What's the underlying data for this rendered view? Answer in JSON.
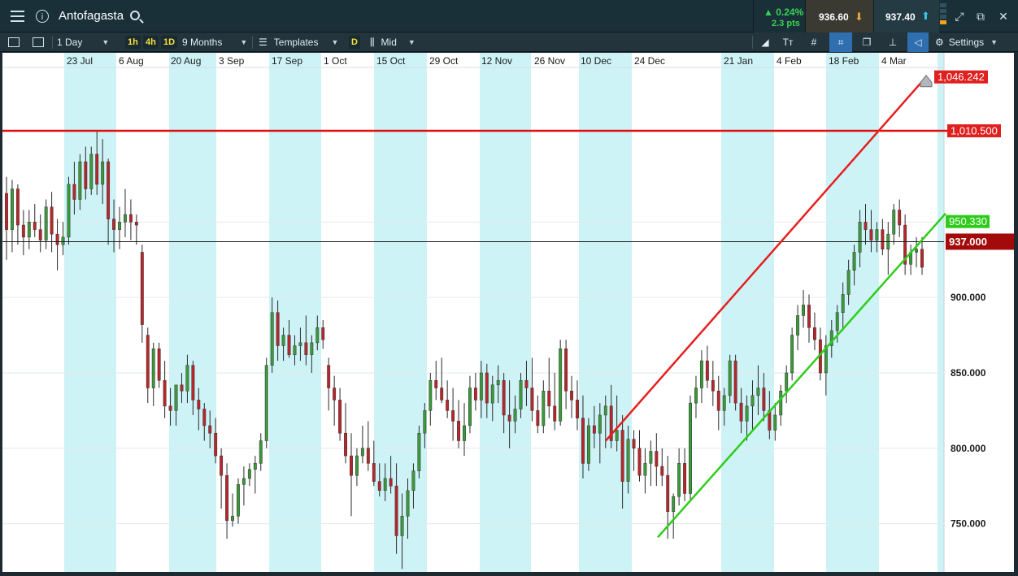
{
  "app": {
    "instrument": "Antofagasta",
    "change_pct": "▲ 0.24%",
    "change_pts": "2.3 pts",
    "sell_price": "936.60",
    "buy_price": "937.40"
  },
  "toolbar": {
    "interval": "1 Day",
    "quick_intervals": [
      "1h",
      "4h",
      "1D"
    ],
    "range": "9 Months",
    "templates_label": "Templates",
    "price_type_chip": "D",
    "price_type": "Mid",
    "settings_label": "Settings"
  },
  "chart_data": {
    "type": "candlestick",
    "x_dates": [
      "23 Jul",
      "6 Aug",
      "20 Aug",
      "3 Sep",
      "17 Sep",
      "1 Oct",
      "15 Oct",
      "29 Oct",
      "12 Nov",
      "26 Nov",
      "10 Dec",
      "24 Dec",
      "21 Jan",
      "4 Feb",
      "18 Feb",
      "4 Mar"
    ],
    "y_tick_labels": [
      "750.000",
      "800.000",
      "850.000",
      "900.000",
      "950.000"
    ],
    "ylim": [
      718,
      1052
    ],
    "price_labels": {
      "resistance": "1,010.500",
      "channel_top": "1,046.242",
      "channel_bottom": "950.330",
      "current": "937.000"
    },
    "colors": {
      "up": "#3a9a3a",
      "down": "#b8262b",
      "resistance": "#e01010",
      "channel_top": "#e81e1e",
      "channel_bottom": "#2ecc1a"
    },
    "lines": {
      "resistance": 1010.5,
      "current": 937.0,
      "channel_top": {
        "from": {
          "date": "12 Dec",
          "price": 805
        },
        "to": {
          "date": "11 Mar",
          "price": 1046.242
        }
      },
      "channel_bottom": {
        "from": {
          "date": "2 Jan",
          "price": 741
        },
        "to": {
          "date": "12 Mar",
          "price": 950.33
        }
      }
    },
    "candles": [
      [
        969,
        980,
        925,
        945
      ],
      [
        945,
        978,
        930,
        972
      ],
      [
        972,
        975,
        935,
        948
      ],
      [
        948,
        958,
        928,
        940
      ],
      [
        940,
        958,
        932,
        950
      ],
      [
        950,
        962,
        940,
        945
      ],
      [
        945,
        955,
        930,
        938
      ],
      [
        938,
        965,
        932,
        960
      ],
      [
        960,
        970,
        930,
        942
      ],
      [
        942,
        952,
        918,
        935
      ],
      [
        935,
        950,
        928,
        940
      ],
      [
        940,
        980,
        935,
        975
      ],
      [
        975,
        990,
        955,
        965
      ],
      [
        965,
        995,
        958,
        990
      ],
      [
        990,
        1000,
        965,
        972
      ],
      [
        972,
        1000,
        968,
        995
      ],
      [
        995,
        1010,
        968,
        975
      ],
      [
        975,
        1005,
        962,
        990
      ],
      [
        990,
        992,
        935,
        952
      ],
      [
        952,
        965,
        930,
        945
      ],
      [
        945,
        960,
        932,
        950
      ],
      [
        950,
        972,
        940,
        955
      ],
      [
        955,
        965,
        938,
        950
      ],
      [
        950,
        955,
        935,
        948
      ],
      [
        930,
        935,
        870,
        882
      ],
      [
        875,
        880,
        830,
        840
      ],
      [
        840,
        870,
        828,
        866
      ],
      [
        866,
        870,
        840,
        845
      ],
      [
        845,
        858,
        820,
        828
      ],
      [
        828,
        840,
        815,
        825
      ],
      [
        825,
        840,
        815,
        842
      ],
      [
        842,
        850,
        830,
        838
      ],
      [
        838,
        862,
        830,
        855
      ],
      [
        855,
        858,
        822,
        832
      ],
      [
        832,
        840,
        812,
        826
      ],
      [
        826,
        830,
        805,
        815
      ],
      [
        815,
        825,
        800,
        810
      ],
      [
        810,
        820,
        790,
        795
      ],
      [
        795,
        800,
        760,
        782
      ],
      [
        782,
        790,
        740,
        752
      ],
      [
        752,
        770,
        748,
        755
      ],
      [
        755,
        780,
        750,
        776
      ],
      [
        776,
        788,
        762,
        780
      ],
      [
        780,
        790,
        775,
        786
      ],
      [
        786,
        795,
        770,
        790
      ],
      [
        790,
        810,
        785,
        805
      ],
      [
        805,
        860,
        800,
        855
      ],
      [
        855,
        900,
        850,
        890
      ],
      [
        890,
        898,
        858,
        868
      ],
      [
        868,
        880,
        858,
        875
      ],
      [
        875,
        885,
        860,
        862
      ],
      [
        862,
        875,
        855,
        868
      ],
      [
        868,
        880,
        858,
        870
      ],
      [
        870,
        888,
        855,
        862
      ],
      [
        862,
        875,
        850,
        870
      ],
      [
        870,
        888,
        865,
        880
      ],
      [
        880,
        885,
        866,
        872
      ],
      [
        855,
        860,
        825,
        840
      ],
      [
        840,
        848,
        815,
        832
      ],
      [
        832,
        840,
        805,
        810
      ],
      [
        810,
        830,
        790,
        795
      ],
      [
        795,
        810,
        755,
        782
      ],
      [
        782,
        800,
        775,
        795
      ],
      [
        795,
        815,
        790,
        800
      ],
      [
        800,
        818,
        785,
        790
      ],
      [
        790,
        805,
        775,
        778
      ],
      [
        778,
        790,
        768,
        772
      ],
      [
        772,
        790,
        765,
        780
      ],
      [
        780,
        795,
        770,
        775
      ],
      [
        775,
        790,
        730,
        742
      ],
      [
        742,
        770,
        720,
        755
      ],
      [
        755,
        780,
        740,
        772
      ],
      [
        772,
        790,
        760,
        785
      ],
      [
        785,
        815,
        780,
        810
      ],
      [
        810,
        830,
        800,
        825
      ],
      [
        825,
        850,
        815,
        845
      ],
      [
        845,
        858,
        832,
        840
      ],
      [
        840,
        860,
        830,
        832
      ],
      [
        832,
        845,
        820,
        825
      ],
      [
        825,
        840,
        805,
        818
      ],
      [
        818,
        832,
        800,
        805
      ],
      [
        805,
        830,
        795,
        815
      ],
      [
        815,
        848,
        810,
        840
      ],
      [
        840,
        850,
        825,
        832
      ],
      [
        832,
        858,
        820,
        850
      ],
      [
        850,
        856,
        820,
        830
      ],
      [
        830,
        848,
        818,
        842
      ],
      [
        842,
        855,
        830,
        845
      ],
      [
        845,
        850,
        810,
        822
      ],
      [
        822,
        845,
        800,
        818
      ],
      [
        818,
        835,
        810,
        826
      ],
      [
        826,
        850,
        820,
        845
      ],
      [
        845,
        858,
        828,
        840
      ],
      [
        840,
        860,
        818,
        825
      ],
      [
        825,
        835,
        810,
        815
      ],
      [
        815,
        845,
        810,
        838
      ],
      [
        838,
        860,
        820,
        828
      ],
      [
        828,
        850,
        812,
        818
      ],
      [
        818,
        872,
        815,
        866
      ],
      [
        866,
        872,
        826,
        838
      ],
      [
        838,
        848,
        820,
        832
      ],
      [
        832,
        845,
        812,
        820
      ],
      [
        820,
        835,
        780,
        790
      ],
      [
        790,
        820,
        785,
        815
      ],
      [
        815,
        828,
        800,
        810
      ],
      [
        810,
        830,
        790,
        822
      ],
      [
        822,
        835,
        800,
        828
      ],
      [
        828,
        842,
        800,
        805
      ],
      [
        805,
        835,
        798,
        812
      ],
      [
        812,
        822,
        760,
        778
      ],
      [
        778,
        815,
        770,
        806
      ],
      [
        806,
        812,
        785,
        800
      ],
      [
        800,
        812,
        778,
        782
      ],
      [
        782,
        800,
        770,
        790
      ],
      [
        790,
        805,
        775,
        798
      ],
      [
        798,
        810,
        775,
        788
      ],
      [
        788,
        800,
        775,
        782
      ],
      [
        782,
        795,
        740,
        758
      ],
      [
        758,
        770,
        740,
        768
      ],
      [
        768,
        800,
        762,
        790
      ],
      [
        790,
        800,
        765,
        770
      ],
      [
        770,
        835,
        765,
        830
      ],
      [
        830,
        848,
        820,
        840
      ],
      [
        840,
        865,
        830,
        858
      ],
      [
        858,
        868,
        840,
        845
      ],
      [
        845,
        858,
        828,
        838
      ],
      [
        838,
        848,
        812,
        825
      ],
      [
        825,
        840,
        815,
        835
      ],
      [
        835,
        862,
        830,
        858
      ],
      [
        858,
        862,
        825,
        830
      ],
      [
        830,
        840,
        810,
        818
      ],
      [
        818,
        835,
        805,
        828
      ],
      [
        828,
        845,
        812,
        835
      ],
      [
        835,
        855,
        822,
        840
      ],
      [
        840,
        850,
        818,
        825
      ],
      [
        825,
        838,
        806,
        812
      ],
      [
        812,
        830,
        805,
        822
      ],
      [
        822,
        842,
        815,
        838
      ],
      [
        838,
        855,
        830,
        850
      ],
      [
        850,
        880,
        845,
        875
      ],
      [
        875,
        895,
        865,
        888
      ],
      [
        888,
        905,
        880,
        895
      ],
      [
        895,
        902,
        870,
        880
      ],
      [
        880,
        890,
        865,
        872
      ],
      [
        872,
        880,
        845,
        850
      ],
      [
        850,
        875,
        835,
        868
      ],
      [
        868,
        885,
        860,
        878
      ],
      [
        878,
        895,
        870,
        890
      ],
      [
        890,
        910,
        878,
        902
      ],
      [
        902,
        925,
        895,
        918
      ],
      [
        918,
        935,
        908,
        930
      ],
      [
        930,
        958,
        920,
        950
      ],
      [
        950,
        962,
        935,
        945
      ],
      [
        945,
        958,
        930,
        938
      ],
      [
        938,
        950,
        930,
        945
      ],
      [
        945,
        952,
        928,
        932
      ],
      [
        932,
        950,
        915,
        942
      ],
      [
        942,
        962,
        935,
        958
      ],
      [
        958,
        965,
        940,
        948
      ],
      [
        948,
        955,
        915,
        922
      ],
      [
        922,
        935,
        915,
        930
      ],
      [
        930,
        940,
        920,
        932
      ],
      [
        932,
        940,
        915,
        920
      ]
    ]
  }
}
